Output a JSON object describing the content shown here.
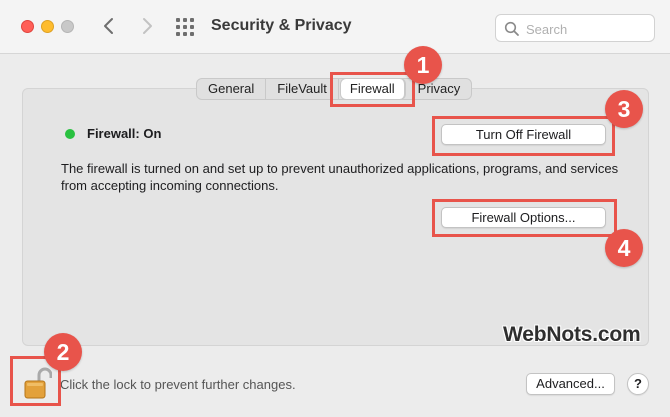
{
  "window": {
    "title": "Security & Privacy",
    "search_placeholder": "Search"
  },
  "tabs": [
    {
      "label": "General",
      "active": false
    },
    {
      "label": "FileVault",
      "active": false
    },
    {
      "label": "Firewall",
      "active": true
    },
    {
      "label": "Privacy",
      "active": false
    }
  ],
  "firewall": {
    "status_label": "Firewall: On",
    "status_color": "#29c140",
    "turn_off_label": "Turn Off Firewall",
    "description": "The firewall is turned on and set up to prevent unauthorized applications, programs, and services from accepting incoming connections.",
    "options_label": "Firewall Options..."
  },
  "footer": {
    "lock_text": "Click the lock to prevent further changes.",
    "advanced_label": "Advanced...",
    "help_label": "?"
  },
  "annotations": {
    "badges": [
      "1",
      "2",
      "3",
      "4"
    ],
    "highlight_color": "#e8544b",
    "watermark": "WebNots.com"
  }
}
